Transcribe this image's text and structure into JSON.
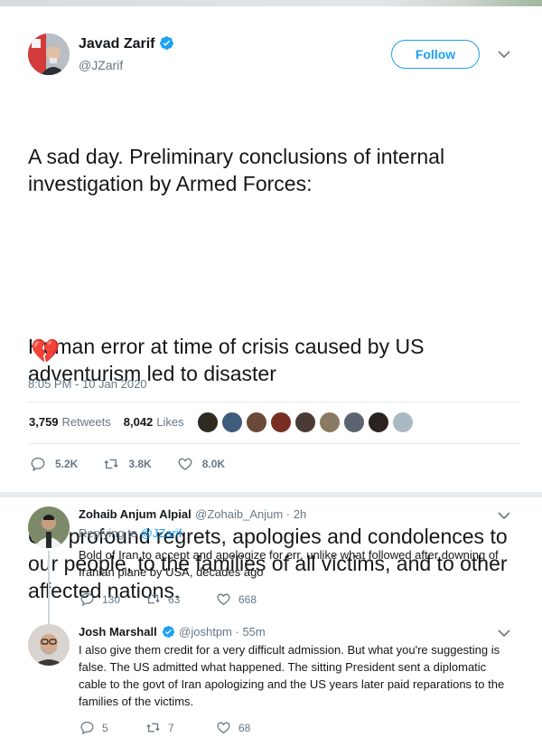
{
  "tweet": {
    "author_name": "Javad Zarif",
    "author_handle": "@JZarif",
    "follow_label": "Follow",
    "text_p1": "A sad day. Preliminary conclusions of internal investigation by Armed Forces:",
    "text_p2": "Human error at time of crisis caused by US adventurism led to disaster",
    "text_p3": "Our profound regrets, apologies and condolences to our people, to the families of all victims, and to other affected nations.",
    "emoji": "💔",
    "timestamp": "8:05 PM - 10 Jan 2020",
    "retweets_count": "3,759",
    "retweets_label": "Retweets",
    "likes_count": "8,042",
    "likes_label": "Likes",
    "actions": {
      "replies": "5.2K",
      "retweets": "3.8K",
      "likes": "8.0K"
    }
  },
  "replies": [
    {
      "author_name": "Zohaib Anjum Alpial",
      "author_handle": "@Zohaib_Anjum",
      "time": "2h",
      "replying_prefix": "Replying to",
      "replying_to": "@JZarif",
      "body": "Bold of Iran to accept and apologize for err, unlike what followed after downing of Iranian plane by USA, decades ago",
      "actions": {
        "replies": "130",
        "retweets": "63",
        "likes": "668"
      }
    },
    {
      "author_name": "Josh Marshall",
      "author_handle": "@joshtpm",
      "time": "55m",
      "body": "I also give them credit for a very difficult admission. But what you're suggesting is false. The US admitted what happened. The sitting President sent a diplomatic cable to the govt of Iran apologizing and the US years later paid reparations to the families of the victims.",
      "actions": {
        "replies": "5",
        "retweets": "7",
        "likes": "68"
      }
    }
  ],
  "colors": {
    "accent": "#1da1f2",
    "text": "#14171a",
    "muted": "#657786",
    "divider": "#e6ecf0"
  }
}
